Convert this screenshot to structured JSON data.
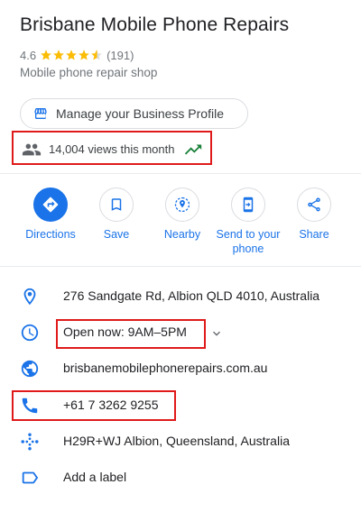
{
  "business": {
    "name": "Brisbane Mobile Phone Repairs",
    "rating": "4.6",
    "review_count": "(191)",
    "stars": 4.5,
    "category": "Mobile phone repair shop"
  },
  "manage_profile": {
    "label": "Manage your Business Profile"
  },
  "views": {
    "text": "14,004 views this month"
  },
  "actions": [
    {
      "label": "Directions",
      "icon": "directions-icon"
    },
    {
      "label": "Save",
      "icon": "bookmark-icon"
    },
    {
      "label": "Nearby",
      "icon": "nearby-icon"
    },
    {
      "label_line1": "Send to your",
      "label_line2": "phone",
      "icon": "send-to-phone-icon"
    },
    {
      "label": "Share",
      "icon": "share-icon"
    }
  ],
  "info": {
    "address": "276 Sandgate Rd, Albion QLD 4010, Australia",
    "hours": "Open now:  9AM–5PM",
    "website": "brisbanemobilephonerepairs.com.au",
    "phone": "+61 7 3262 9255",
    "plus_code": "H29R+WJ Albion, Queensland, Australia",
    "add_label": "Add a label"
  },
  "colors": {
    "accent": "#1a73e8",
    "star": "#fbbc04",
    "highlight": "#e01a1a",
    "trend": "#188038"
  }
}
